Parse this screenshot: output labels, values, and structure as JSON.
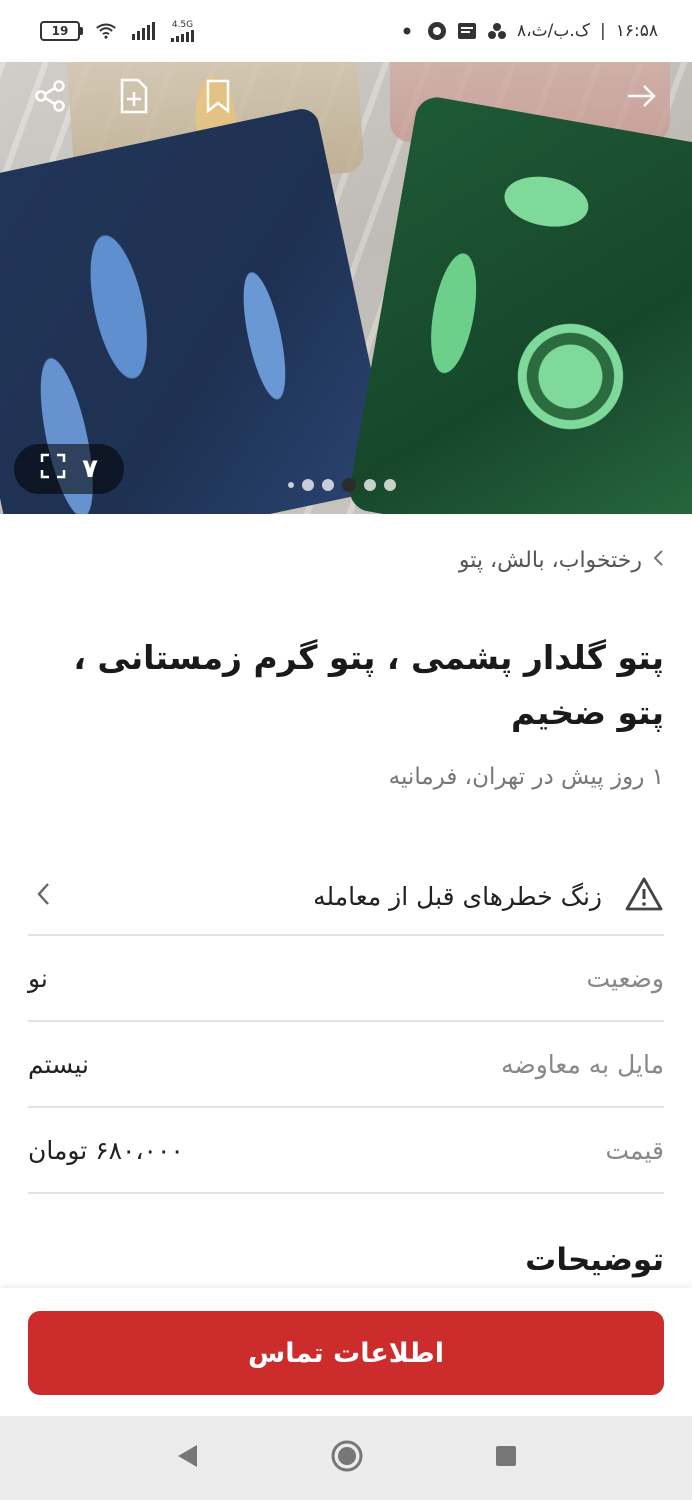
{
  "status_bar": {
    "battery": "19",
    "network": "4.5G",
    "clock": "۱۶:۵۸",
    "date": "۸،ک.ب/ث"
  },
  "hero": {
    "image_count": "۷",
    "dots_total": 6,
    "active_dot": 4
  },
  "breadcrumb": {
    "path": "رختخواب، بالش، پتو"
  },
  "listing": {
    "title": "پتو گلدار پشمی ، پتو گرم زمستانی ، پتو ضخیم",
    "meta": "۱ روز پیش در تهران، فرمانیه"
  },
  "warning": {
    "label": "زنگ خطرهای قبل از معامله"
  },
  "details": [
    {
      "key": "وضعیت",
      "value": "نو"
    },
    {
      "key": "مایل به معاوضه",
      "value": "نیستم"
    },
    {
      "key": "قیمت",
      "value": "۶۸۰،۰۰۰ تومان"
    }
  ],
  "description": {
    "heading": "توضیحات"
  },
  "cta": {
    "label": "اطلاعات تماس"
  },
  "colors": {
    "accent": "#cc2c2c",
    "divider": "#e3e3e3"
  }
}
